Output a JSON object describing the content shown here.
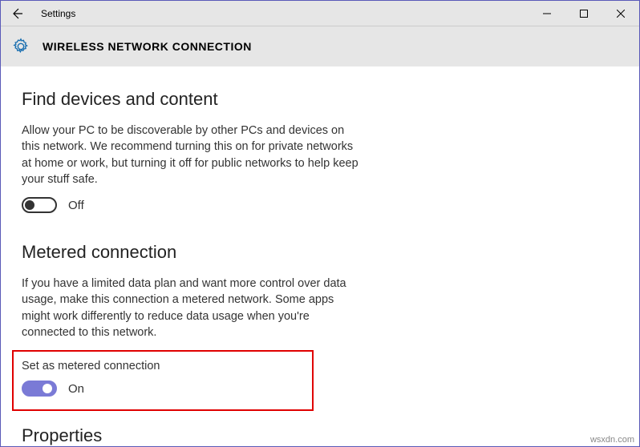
{
  "titlebar": {
    "app_title": "Settings"
  },
  "header": {
    "page_title": "WIRELESS NETWORK CONNECTION"
  },
  "sections": {
    "find_devices": {
      "heading": "Find devices and content",
      "description": "Allow your PC to be discoverable by other PCs and devices on this network. We recommend turning this on for private networks at home or work, but turning it off for public networks to help keep your stuff safe.",
      "toggle_state": "Off"
    },
    "metered": {
      "heading": "Metered connection",
      "description": "If you have a limited data plan and want more control over data usage, make this connection a metered network. Some apps might work differently to reduce data usage when you're connected to this network.",
      "toggle_label": "Set as metered connection",
      "toggle_state": "On"
    },
    "properties": {
      "heading": "Properties"
    }
  },
  "watermark": "wsxdn.com"
}
